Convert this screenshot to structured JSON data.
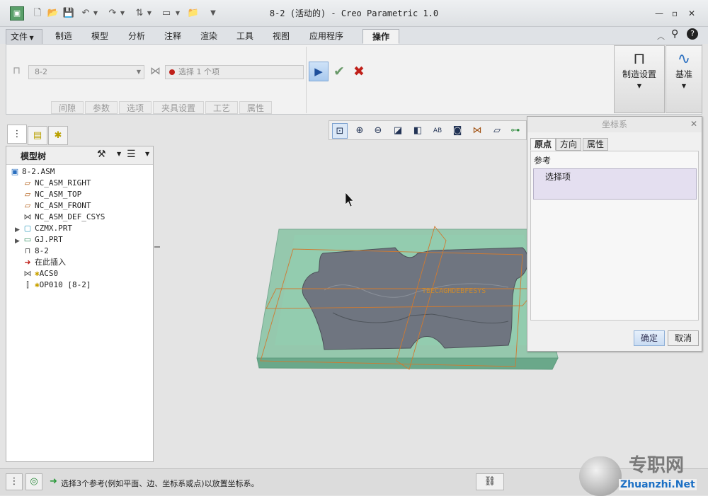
{
  "window": {
    "title": "8-2 (活动的) - Creo Parametric 1.0"
  },
  "ribbon_tabs": [
    {
      "label": "文件"
    },
    {
      "label": "制造"
    },
    {
      "label": "模型"
    },
    {
      "label": "分析"
    },
    {
      "label": "注释"
    },
    {
      "label": "渲染"
    },
    {
      "label": "工具"
    },
    {
      "label": "视图"
    },
    {
      "label": "应用程序"
    },
    {
      "label": "操作"
    }
  ],
  "operation": {
    "name_value": "8-2",
    "csys_collector_value": "选择 1 个项",
    "subtabs": [
      "间隙",
      "参数",
      "选项",
      "夹具设置",
      "工艺",
      "属性"
    ]
  },
  "ribbon_right": {
    "mfg_setup_label": "制造设置",
    "datum_label": "基准"
  },
  "model_tree": {
    "title": "模型树",
    "items": [
      {
        "label": "8-2.ASM",
        "icon": "assembly-icon"
      },
      {
        "label": "NC_ASM_RIGHT",
        "icon": "datum-plane-icon"
      },
      {
        "label": "NC_ASM_TOP",
        "icon": "datum-plane-icon"
      },
      {
        "label": "NC_ASM_FRONT",
        "icon": "datum-plane-icon"
      },
      {
        "label": "NC_ASM_DEF_CSYS",
        "icon": "csys-icon"
      },
      {
        "label": "CZMX.PRT",
        "icon": "part-icon"
      },
      {
        "label": "GJ.PRT",
        "icon": "part-icon"
      },
      {
        "label": "8-2",
        "icon": "workcell-icon"
      },
      {
        "label": "在此插入",
        "icon": "insert-arrow-icon"
      },
      {
        "label": "ACS0",
        "icon": "csys-icon"
      },
      {
        "label": "OP010 [8-2]",
        "icon": "operation-icon"
      }
    ]
  },
  "viewport": {
    "model_text": "TBECAGHDEBFESYS"
  },
  "csys_dialog": {
    "title": "坐标系",
    "tabs": [
      "原点",
      "方向",
      "属性"
    ],
    "references_label": "参考",
    "selection_placeholder": "选择项",
    "ok_label": "确定",
    "cancel_label": "取消"
  },
  "status": {
    "message": "选择3个参考(例如平面、边、坐标系或点)以放置坐标系。"
  },
  "watermark": {
    "site_name": "专职网",
    "site_url": "Zhuanzhi.Net"
  },
  "colors": {
    "accent_blue": "#3a6fc6",
    "confirm_green": "#6a9a6a",
    "cancel_red": "#c0201a",
    "workpiece_green": "#82c2a0",
    "part_gray": "#6f7580"
  }
}
